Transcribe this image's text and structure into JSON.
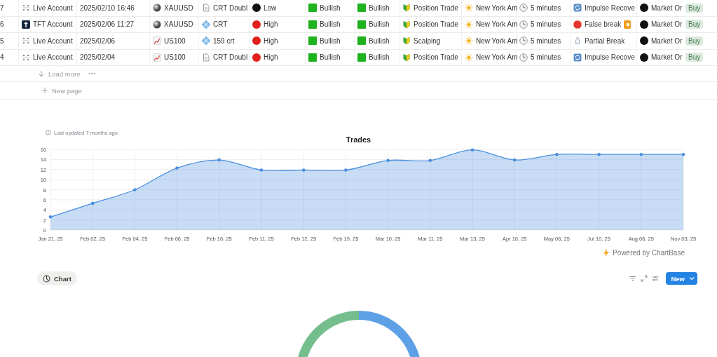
{
  "table": {
    "rows": [
      {
        "index": "7",
        "account": {
          "kind": "live",
          "label": "Live Account"
        },
        "date": "2025/02/10 16:46",
        "symbol": {
          "kind": "metal",
          "label": "XAUUSD"
        },
        "setup": {
          "kind": "document",
          "label": "CRT Doubl"
        },
        "risk": {
          "label": "Low",
          "color": "#111111"
        },
        "bias_1": "Bullish",
        "bias_2": "Bullish",
        "style": "Position Trade",
        "session": "New York Am",
        "timeframe": "5 minutes",
        "entry": {
          "kind": "cycle",
          "label": "Impulse Recove",
          "extra_icon": false
        },
        "order": "Market Or",
        "side": "Buy"
      },
      {
        "index": "6",
        "account": {
          "kind": "tft",
          "label": "TFT Account"
        },
        "date": "2025/02/06 11:27",
        "symbol": {
          "kind": "metal",
          "label": "XAUUSD"
        },
        "setup": {
          "kind": "diamond",
          "label": "CRT"
        },
        "risk": {
          "label": "High",
          "color": "#e0201b"
        },
        "bias_1": "Bullish",
        "bias_2": "Bullish",
        "style": "Position Trade",
        "session": "New York Am",
        "timeframe": "5 minutes",
        "entry": {
          "kind": "stop",
          "label": "False break",
          "extra_icon": true
        },
        "order": "Market Or",
        "side": "Buy"
      },
      {
        "index": "5",
        "account": {
          "kind": "live",
          "label": "Live Account"
        },
        "date": "2025/02/06",
        "symbol": {
          "kind": "index",
          "label": "US100"
        },
        "setup": {
          "kind": "diamond",
          "label": "159 crt"
        },
        "risk": {
          "label": "High",
          "color": "#e0201b"
        },
        "bias_1": "Bullish",
        "bias_2": "Bullish",
        "style": "Scalping",
        "session": "New York Am",
        "timeframe": "5 minutes",
        "entry": {
          "kind": "drop",
          "label": "Partial Break",
          "extra_icon": false
        },
        "order": "Market Or",
        "side": "Buy"
      },
      {
        "index": "4",
        "account": {
          "kind": "live",
          "label": "Live Account"
        },
        "date": "2025/02/04",
        "symbol": {
          "kind": "index",
          "label": "US100"
        },
        "setup": {
          "kind": "document",
          "label": "CRT Doubl"
        },
        "risk": {
          "label": "High",
          "color": "#e0201b"
        },
        "bias_1": "Bullish",
        "bias_2": "Bullish",
        "style": "Position Trade",
        "session": "New York Am",
        "timeframe": "5 minutes",
        "entry": {
          "kind": "cycle",
          "label": "Impulse Recove",
          "extra_icon": false
        },
        "order": "Market Or",
        "side": "Buy"
      }
    ],
    "load_more": "Load more",
    "new_page": "New page"
  },
  "chart": {
    "last_updated": "Last updated 7 months ago",
    "powered_by": "Powered by ChartBase",
    "chart_data": {
      "type": "area",
      "title": "Trades",
      "categories": [
        "Jan 21, 25",
        "Feb 02, 25",
        "Feb 04, 25",
        "Feb 06, 25",
        "Feb 10, 25",
        "Feb 11, 25",
        "Feb 12, 25",
        "Feb 19, 25",
        "Mar 10, 25",
        "Mar 11, 25",
        "Mar 13, 25",
        "Apr 10, 25",
        "May 06, 25",
        "Jul 10, 25",
        "Aug 06, 25",
        "Nov 03, 25"
      ],
      "grid": true,
      "series": [
        {
          "color": "#4a8fdf",
          "values": [
            2.6,
            5.3,
            8,
            12.3,
            13.9,
            11.9,
            11.9,
            11.9,
            13.8,
            13.8,
            15.9,
            13.9,
            15,
            15,
            15,
            15
          ]
        }
      ],
      "ylim": [
        0,
        16
      ],
      "yticks": [
        0,
        2,
        4,
        6,
        8,
        10,
        12,
        14,
        16
      ]
    }
  },
  "view_bar": {
    "view_tab": "Chart",
    "new_button": "New"
  }
}
